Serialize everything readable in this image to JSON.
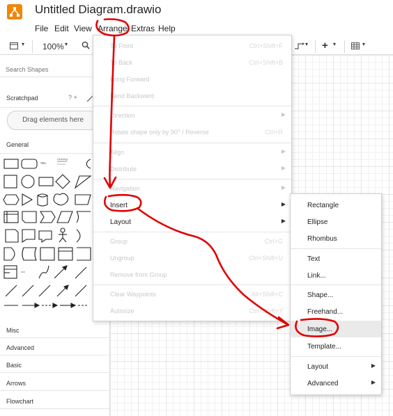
{
  "app": {
    "title": "Untitled Diagram.drawio",
    "menus": [
      "File",
      "Edit",
      "View",
      "Arrange",
      "Extras",
      "Help"
    ],
    "brand_color": "#f08705"
  },
  "toolbar": {
    "zoom": "100%",
    "glyph_plus": "+",
    "caret": "▾",
    "icons": [
      "view-icon",
      "zoom-icon",
      "waypoint-icon",
      "insert-plus-icon",
      "table-icon"
    ]
  },
  "sidebar": {
    "search_placeholder": "Search Shapes",
    "scratchpad": "Scratchpad",
    "scratch_actions": "? + ",
    "drag_hint": "Drag elements here",
    "general": "General",
    "categories": [
      "Misc",
      "Advanced",
      "Basic",
      "Arrows",
      "Flowchart"
    ],
    "shape_text_label": "Text",
    "shape_heading_label": "Heading"
  },
  "arrange_menu": {
    "items": [
      {
        "label": "To Front",
        "shortcut": "Ctrl+Shift+F"
      },
      {
        "label": "To Back",
        "shortcut": "Ctrl+Shift+B"
      },
      {
        "label": "Bring Forward",
        "shortcut": ""
      },
      {
        "label": "Send Backward",
        "shortcut": ""
      },
      {
        "label": "Direction",
        "shortcut": ""
      },
      {
        "label": "Rotate shape only by 90° / Reverse",
        "shortcut": "Ctrl+R"
      },
      {
        "label": "Align",
        "shortcut": ""
      },
      {
        "label": "Distribute",
        "shortcut": ""
      },
      {
        "label": "Navigation",
        "shortcut": ""
      },
      {
        "label": "Insert",
        "shortcut": ""
      },
      {
        "label": "Layout",
        "shortcut": ""
      },
      {
        "label": "Group",
        "shortcut": "Ctrl+G"
      },
      {
        "label": "Ungroup",
        "shortcut": "Ctrl+Shift+U"
      },
      {
        "label": "Remove from Group",
        "shortcut": ""
      },
      {
        "label": "Clear Waypoints",
        "shortcut": "Alt+Shift+C"
      },
      {
        "label": "Autosize",
        "shortcut": "Ctrl+Shift+Y"
      }
    ],
    "submenu_arrow": "▶"
  },
  "insert_menu": {
    "items": [
      "Rectangle",
      "Ellipse",
      "Rhombus",
      "Text",
      "Link...",
      "Shape...",
      "Freehand...",
      "Image...",
      "Template...",
      "Layout",
      "Advanced"
    ],
    "highlighted": "Image..."
  },
  "annotation_color": "#e00000"
}
